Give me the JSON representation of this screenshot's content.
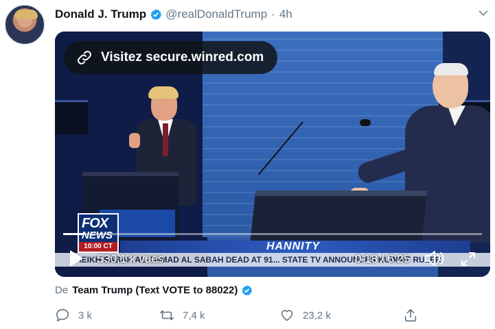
{
  "tweet": {
    "author_name": "Donald J. Trump",
    "author_handle": "@realDonaldTrump",
    "separator": "·",
    "time": "4h"
  },
  "media": {
    "url_label": "Visitez secure.winred.com",
    "views": "530,1 k vues",
    "timecode": "0:18 / 6:25",
    "progress": 0.047,
    "broadcast": {
      "logo_top": "FOX",
      "logo_bottom": "NEWS",
      "logo_time": "10:00 CT",
      "show": "HANNITY",
      "ticker": "SHEIKH SABAH AL-AHMAD AL SABAH DEAD AT 91...  STATE TV ANNOUNCES KUWAIT RULER"
    }
  },
  "source": {
    "prefix": "De",
    "name": "Team Trump (Text VOTE to 88022)"
  },
  "actions": {
    "reply_count": "3 k",
    "retweet_count": "7,4 k",
    "like_count": "23,2 k"
  },
  "colors": {
    "verified": "#1da1f2",
    "secondary_text": "#657786"
  },
  "icons": [
    "verified-icon",
    "chevron-down-icon",
    "link-icon",
    "play-icon",
    "volume-icon",
    "fullscreen-icon",
    "reply-icon",
    "retweet-icon",
    "like-icon",
    "share-icon"
  ]
}
